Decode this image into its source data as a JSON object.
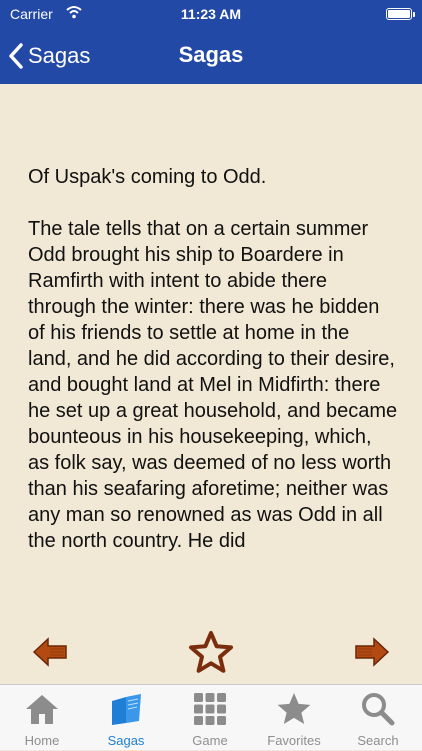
{
  "status_bar": {
    "carrier": "Carrier",
    "time": "11:23 AM"
  },
  "nav": {
    "back_label": "Sagas",
    "title": "Sagas",
    "color": "#2349a6"
  },
  "content": {
    "text": "Of Uspak's coming to Odd.\n\nThe tale tells that on a certain summer Odd brought his ship to Boardere in Ramfirth with intent to abide there through the winter: there was he bidden of his friends to settle at home in the land, and he did according to their desire, and bought land at Mel in Midfirth: there he set up a great household, and became bounteous in his housekeeping, which, as folk say, was deemed of no less worth than his seafaring aforetime; neither was any man so renowned as was Odd in all the north country. He did"
  },
  "actions": {
    "prev_icon": "left-arrow-icon",
    "favorite_icon": "star-outline-icon",
    "next_icon": "right-arrow-icon"
  },
  "tabbar": {
    "active_color": "#1f7fd6",
    "tabs": [
      {
        "label": "Home",
        "icon": "home-icon"
      },
      {
        "label": "Sagas",
        "icon": "book-icon"
      },
      {
        "label": "Game",
        "icon": "grid-icon"
      },
      {
        "label": "Favorites",
        "icon": "star-icon"
      },
      {
        "label": "Search",
        "icon": "magnifier-icon"
      }
    ]
  }
}
